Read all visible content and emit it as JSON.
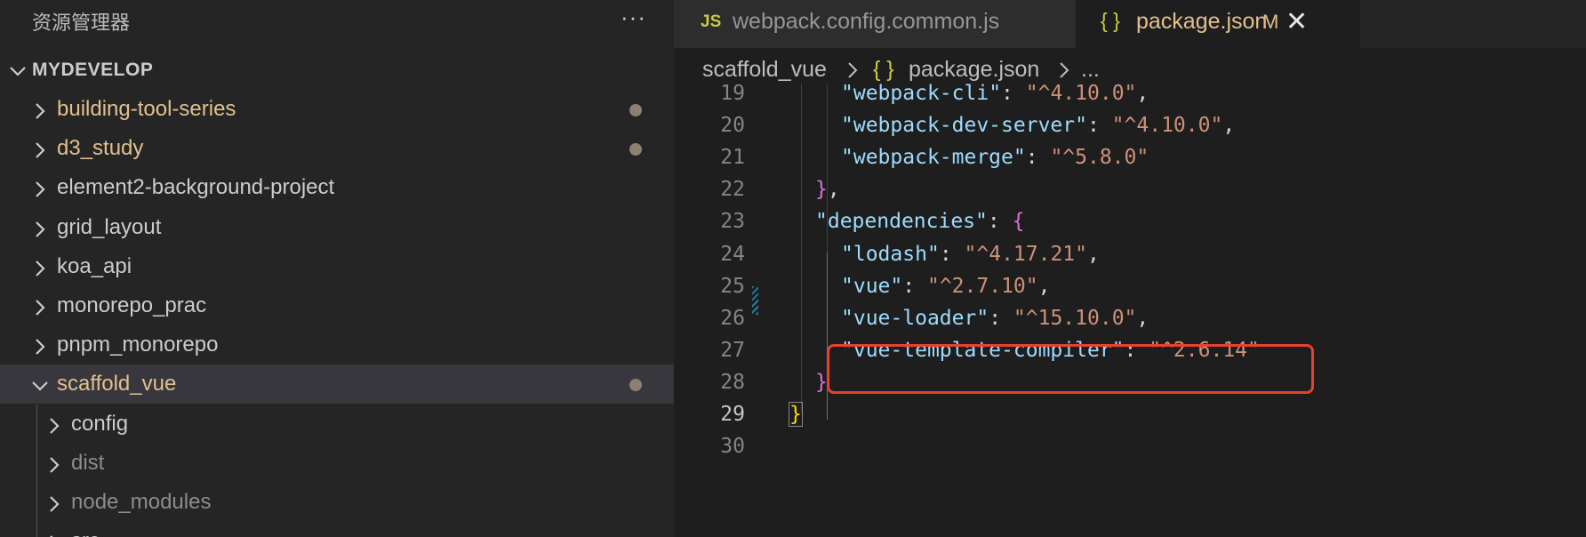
{
  "sidebar": {
    "title": "资源管理器",
    "more_icon": "···",
    "workspace": "MYDEVELOP",
    "items": [
      {
        "label": "building-tool-series",
        "color": "#e2c08d",
        "expanded": false,
        "modified": true
      },
      {
        "label": "d3_study",
        "color": "#e2c08d",
        "expanded": false,
        "modified": true
      },
      {
        "label": "element2-background-project",
        "color": "#cccccc",
        "expanded": false,
        "modified": false
      },
      {
        "label": "grid_layout",
        "color": "#cccccc",
        "expanded": false,
        "modified": false
      },
      {
        "label": "koa_api",
        "color": "#cccccc",
        "expanded": false,
        "modified": false
      },
      {
        "label": "monorepo_prac",
        "color": "#cccccc",
        "expanded": false,
        "modified": false
      },
      {
        "label": "pnpm_monorepo",
        "color": "#cccccc",
        "expanded": false,
        "modified": false
      },
      {
        "label": "scaffold_vue",
        "color": "#e2c08d",
        "expanded": true,
        "modified": true,
        "selected": true
      }
    ],
    "children": [
      {
        "label": "config",
        "color": "#cccccc"
      },
      {
        "label": "dist",
        "color": "#8c8c8c"
      },
      {
        "label": "node_modules",
        "color": "#8c8c8c"
      },
      {
        "label": "src",
        "color": "#cccccc"
      }
    ]
  },
  "tabs": [
    {
      "icon": "JS",
      "title": "webpack.config.common.js",
      "active": false
    },
    {
      "icon": "{ }",
      "title": "package.json",
      "badge": "M",
      "active": true,
      "close": "✕"
    }
  ],
  "breadcrumb": {
    "folder": "scaffold_vue",
    "file_icon": "{ }",
    "file": "package.json",
    "more": "..."
  },
  "editor": {
    "current_line": 29,
    "lines": [
      {
        "n": 19,
        "key": "webpack-cli",
        "value": "^4.10.0",
        "trail": ","
      },
      {
        "n": 20,
        "key": "webpack-dev-server",
        "value": "^4.10.0",
        "trail": ","
      },
      {
        "n": 21,
        "key": "webpack-merge",
        "value": "^5.8.0",
        "trail": ""
      },
      {
        "n": 22,
        "close": "}",
        "trail": ","
      },
      {
        "n": 23,
        "key": "dependencies",
        "open": "{"
      },
      {
        "n": 24,
        "key": "lodash",
        "value": "^4.17.21",
        "trail": ","
      },
      {
        "n": 25,
        "key": "vue",
        "value": "^2.7.10",
        "trail": ","
      },
      {
        "n": 26,
        "key": "vue-loader",
        "value": "^15.10.0",
        "trail": ","
      },
      {
        "n": 27,
        "key": "vue-template-compiler",
        "value": "^2.6.14",
        "trail": ""
      },
      {
        "n": 28,
        "close": "}",
        "trail": ""
      },
      {
        "n": 29,
        "close": "}",
        "trail": ""
      },
      {
        "n": 30
      }
    ]
  },
  "colors": {
    "highlight": "#e8412e",
    "modified": "#e2c08d",
    "json_key": "#9cdcfe",
    "json_string": "#ce9178"
  }
}
